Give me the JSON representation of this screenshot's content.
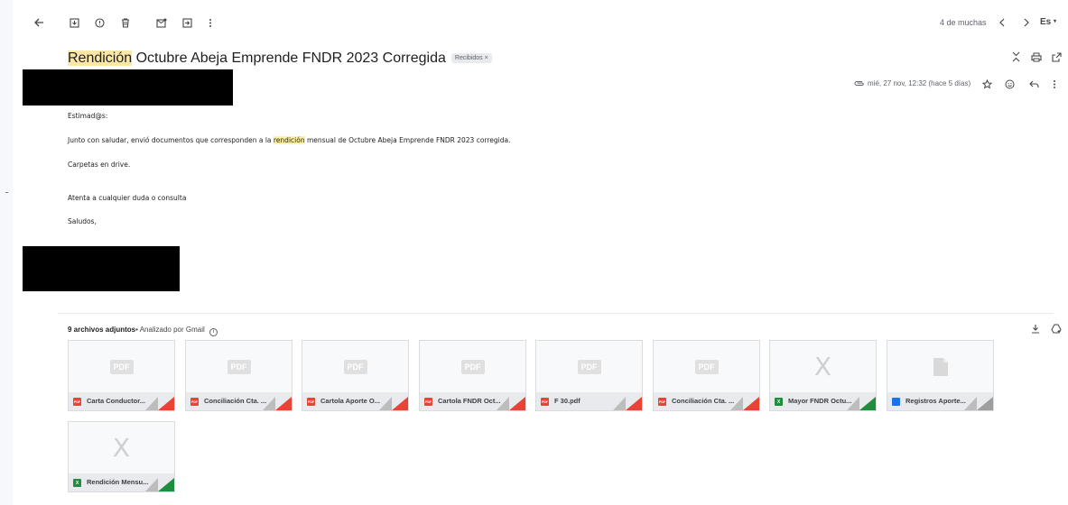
{
  "toolbar": {
    "icons": [
      "back-arrow-icon",
      "archive-icon",
      "report-spam-icon",
      "delete-icon",
      "mark-unread-icon",
      "move-to-icon",
      "more-vert-icon"
    ],
    "count": "4 de muchas",
    "lang": "Es"
  },
  "subject": {
    "highlight": "Rendición",
    "rest": " Octubre Abeja Emprende FNDR 2023 Corregida",
    "label": "Recibidos ×"
  },
  "meta": {
    "date": "mié, 27 nov, 12:32 (hace 5 días)"
  },
  "body": {
    "greeting": "Estimad@s:",
    "line1_before": "Junto con saludar, envió documentos que corresponden a la ",
    "line1_highlight": "rendición",
    "line1_after": " mensual de Octubre Abeja Emprende FNDR 2023 corregida.",
    "line2": "Carpetas en drive.",
    "line3": "Atenta a cualquier duda o consulta",
    "line4": "Saludos,"
  },
  "attachments": {
    "count_label": "9 archivos adjuntos",
    "scan_label": "• Analizado por Gmail",
    "items": [
      {
        "name": "Carta Conductor...",
        "type": "pdf"
      },
      {
        "name": "Conciliación Cta. ...",
        "type": "pdf"
      },
      {
        "name": "Cartola Aporte O...",
        "type": "pdf"
      },
      {
        "name": "Cartola FNDR Oct...",
        "type": "pdf"
      },
      {
        "name": "F 30.pdf",
        "type": "pdf"
      },
      {
        "name": "Conciliación Cta. ...",
        "type": "pdf"
      },
      {
        "name": "Mayor FNDR Octu...",
        "type": "xls"
      },
      {
        "name": "Registros Aporte...",
        "type": "doc"
      },
      {
        "name": "Rendición Mensu...",
        "type": "xls"
      }
    ],
    "pdf_preview_text": "PDF",
    "pdf_icon_text": "PDF",
    "xls_icon_text": "X",
    "xls_preview_text": "X"
  },
  "colors": {
    "pdf": "#ea4335",
    "xls": "#1e8e3e",
    "doc": "#1a73e8",
    "highlight": "#fce8a6"
  }
}
